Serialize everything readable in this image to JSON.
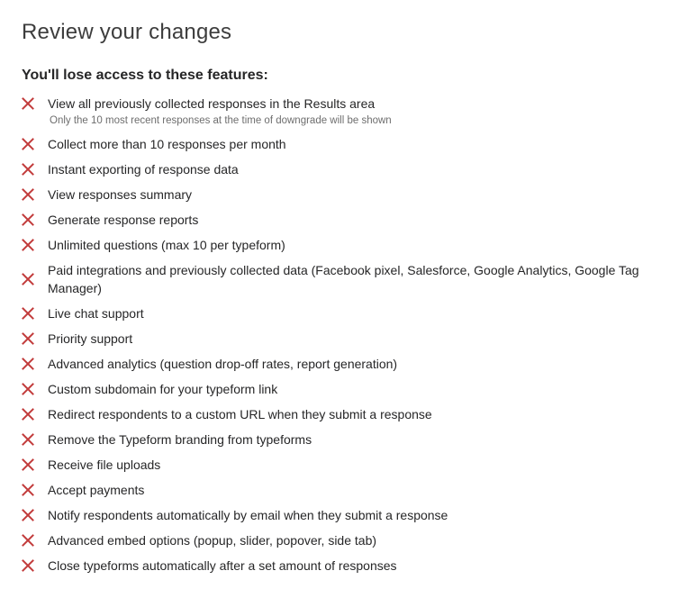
{
  "dialog": {
    "title": "Review your changes",
    "subtitle": "You'll lose access to these features:",
    "icon": "close-x-icon",
    "icon_color": "#c23b3b",
    "features": [
      {
        "label": "View all previously collected responses in the Results area",
        "note": "Only the 10 most recent responses at the time of downgrade will be shown"
      },
      {
        "label": "Collect more than 10 responses per month"
      },
      {
        "label": "Instant exporting of response data"
      },
      {
        "label": "View responses summary"
      },
      {
        "label": "Generate response reports"
      },
      {
        "label": "Unlimited questions (max 10 per typeform)"
      },
      {
        "label": "Paid integrations and previously collected data (Facebook pixel, Salesforce, Google Analytics, Google Tag Manager)"
      },
      {
        "label": "Live chat support"
      },
      {
        "label": "Priority support"
      },
      {
        "label": "Advanced analytics (question drop-off rates, report generation)"
      },
      {
        "label": "Custom subdomain for your typeform link"
      },
      {
        "label": "Redirect respondents to a custom URL when they submit a response"
      },
      {
        "label": "Remove the Typeform branding from typeforms"
      },
      {
        "label": "Receive file uploads"
      },
      {
        "label": "Accept payments"
      },
      {
        "label": "Notify respondents automatically by email when they submit a response"
      },
      {
        "label": "Advanced embed options (popup, slider, popover, side tab)"
      },
      {
        "label": "Close typeforms automatically after a set amount of responses"
      }
    ]
  }
}
